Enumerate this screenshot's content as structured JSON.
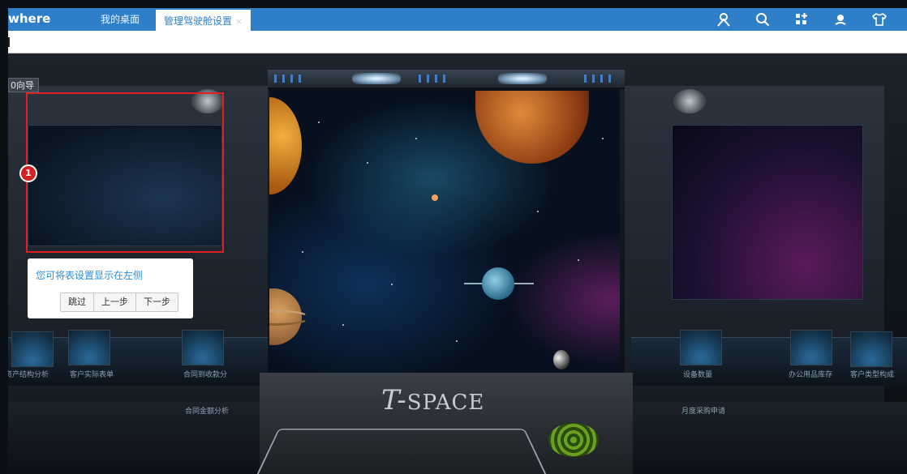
{
  "header": {
    "brand": "where",
    "tabs": [
      {
        "label": "我的桌面"
      },
      {
        "label": "管理驾驶舱设置",
        "close": "×"
      }
    ],
    "icons": [
      "user-icon",
      "search-icon",
      "apps-icon",
      "sun-icon",
      "shirt-icon"
    ]
  },
  "sidebar": {
    "wizard_tag": "0向导"
  },
  "scene": {
    "logo_t": "T-",
    "logo_rest": "SPACE",
    "left_labels": [
      "资产结构分析",
      "客户实际表单",
      "合同到收款分",
      "合同金额分析"
    ],
    "right_labels": [
      "设备数量",
      "办公用品库存",
      "客户类型构成",
      "月度采购申请"
    ]
  },
  "guide": {
    "step": "1",
    "tip_text": "您可将表设置显示在左侧",
    "buttons": {
      "skip": "跳过",
      "prev": "上一步",
      "next": "下一步"
    }
  },
  "colors": {
    "topbar": "#2f7fc8",
    "highlight": "#e02020",
    "tip_text": "#2b8fd6"
  }
}
